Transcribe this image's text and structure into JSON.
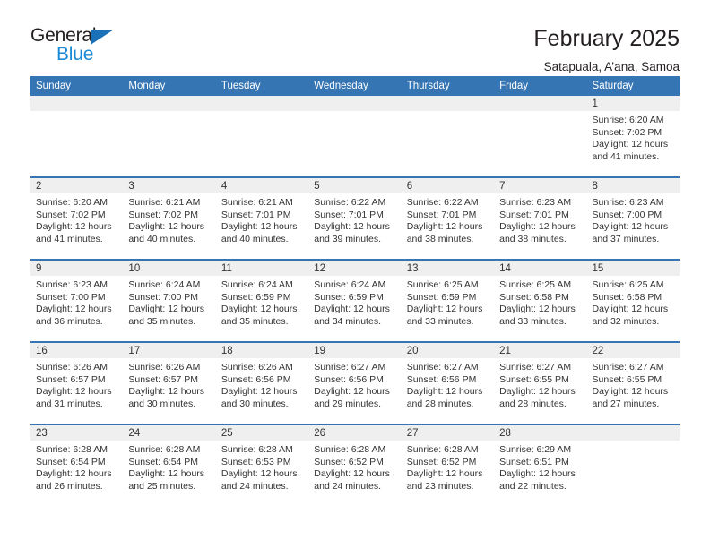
{
  "logo": {
    "word_one": "General",
    "word_two": "Blue",
    "triangle_icon": "triangle-icon",
    "brand_dark": "#231f20",
    "brand_blue": "#1b8ad6",
    "triangle_blue": "#1b71b8"
  },
  "header": {
    "month_title": "February 2025",
    "location": "Satapuala, A’ana, Samoa"
  },
  "colors": {
    "header_row": "#3575b4",
    "daynum_band": "#efefef",
    "text": "#333333"
  },
  "calendar": {
    "weekday_headers": [
      "Sunday",
      "Monday",
      "Tuesday",
      "Wednesday",
      "Thursday",
      "Friday",
      "Saturday"
    ],
    "labels": {
      "sunrise": "Sunrise:",
      "sunset": "Sunset:",
      "daylight": "Daylight:"
    },
    "weeks": [
      [
        {
          "day": "",
          "sunrise": "",
          "sunset": "",
          "daylight": ""
        },
        {
          "day": "",
          "sunrise": "",
          "sunset": "",
          "daylight": ""
        },
        {
          "day": "",
          "sunrise": "",
          "sunset": "",
          "daylight": ""
        },
        {
          "day": "",
          "sunrise": "",
          "sunset": "",
          "daylight": ""
        },
        {
          "day": "",
          "sunrise": "",
          "sunset": "",
          "daylight": ""
        },
        {
          "day": "",
          "sunrise": "",
          "sunset": "",
          "daylight": ""
        },
        {
          "day": "1",
          "sunrise": "Sunrise: 6:20 AM",
          "sunset": "Sunset: 7:02 PM",
          "daylight": "Daylight: 12 hours and 41 minutes."
        }
      ],
      [
        {
          "day": "2",
          "sunrise": "Sunrise: 6:20 AM",
          "sunset": "Sunset: 7:02 PM",
          "daylight": "Daylight: 12 hours and 41 minutes."
        },
        {
          "day": "3",
          "sunrise": "Sunrise: 6:21 AM",
          "sunset": "Sunset: 7:02 PM",
          "daylight": "Daylight: 12 hours and 40 minutes."
        },
        {
          "day": "4",
          "sunrise": "Sunrise: 6:21 AM",
          "sunset": "Sunset: 7:01 PM",
          "daylight": "Daylight: 12 hours and 40 minutes."
        },
        {
          "day": "5",
          "sunrise": "Sunrise: 6:22 AM",
          "sunset": "Sunset: 7:01 PM",
          "daylight": "Daylight: 12 hours and 39 minutes."
        },
        {
          "day": "6",
          "sunrise": "Sunrise: 6:22 AM",
          "sunset": "Sunset: 7:01 PM",
          "daylight": "Daylight: 12 hours and 38 minutes."
        },
        {
          "day": "7",
          "sunrise": "Sunrise: 6:23 AM",
          "sunset": "Sunset: 7:01 PM",
          "daylight": "Daylight: 12 hours and 38 minutes."
        },
        {
          "day": "8",
          "sunrise": "Sunrise: 6:23 AM",
          "sunset": "Sunset: 7:00 PM",
          "daylight": "Daylight: 12 hours and 37 minutes."
        }
      ],
      [
        {
          "day": "9",
          "sunrise": "Sunrise: 6:23 AM",
          "sunset": "Sunset: 7:00 PM",
          "daylight": "Daylight: 12 hours and 36 minutes."
        },
        {
          "day": "10",
          "sunrise": "Sunrise: 6:24 AM",
          "sunset": "Sunset: 7:00 PM",
          "daylight": "Daylight: 12 hours and 35 minutes."
        },
        {
          "day": "11",
          "sunrise": "Sunrise: 6:24 AM",
          "sunset": "Sunset: 6:59 PM",
          "daylight": "Daylight: 12 hours and 35 minutes."
        },
        {
          "day": "12",
          "sunrise": "Sunrise: 6:24 AM",
          "sunset": "Sunset: 6:59 PM",
          "daylight": "Daylight: 12 hours and 34 minutes."
        },
        {
          "day": "13",
          "sunrise": "Sunrise: 6:25 AM",
          "sunset": "Sunset: 6:59 PM",
          "daylight": "Daylight: 12 hours and 33 minutes."
        },
        {
          "day": "14",
          "sunrise": "Sunrise: 6:25 AM",
          "sunset": "Sunset: 6:58 PM",
          "daylight": "Daylight: 12 hours and 33 minutes."
        },
        {
          "day": "15",
          "sunrise": "Sunrise: 6:25 AM",
          "sunset": "Sunset: 6:58 PM",
          "daylight": "Daylight: 12 hours and 32 minutes."
        }
      ],
      [
        {
          "day": "16",
          "sunrise": "Sunrise: 6:26 AM",
          "sunset": "Sunset: 6:57 PM",
          "daylight": "Daylight: 12 hours and 31 minutes."
        },
        {
          "day": "17",
          "sunrise": "Sunrise: 6:26 AM",
          "sunset": "Sunset: 6:57 PM",
          "daylight": "Daylight: 12 hours and 30 minutes."
        },
        {
          "day": "18",
          "sunrise": "Sunrise: 6:26 AM",
          "sunset": "Sunset: 6:56 PM",
          "daylight": "Daylight: 12 hours and 30 minutes."
        },
        {
          "day": "19",
          "sunrise": "Sunrise: 6:27 AM",
          "sunset": "Sunset: 6:56 PM",
          "daylight": "Daylight: 12 hours and 29 minutes."
        },
        {
          "day": "20",
          "sunrise": "Sunrise: 6:27 AM",
          "sunset": "Sunset: 6:56 PM",
          "daylight": "Daylight: 12 hours and 28 minutes."
        },
        {
          "day": "21",
          "sunrise": "Sunrise: 6:27 AM",
          "sunset": "Sunset: 6:55 PM",
          "daylight": "Daylight: 12 hours and 28 minutes."
        },
        {
          "day": "22",
          "sunrise": "Sunrise: 6:27 AM",
          "sunset": "Sunset: 6:55 PM",
          "daylight": "Daylight: 12 hours and 27 minutes."
        }
      ],
      [
        {
          "day": "23",
          "sunrise": "Sunrise: 6:28 AM",
          "sunset": "Sunset: 6:54 PM",
          "daylight": "Daylight: 12 hours and 26 minutes."
        },
        {
          "day": "24",
          "sunrise": "Sunrise: 6:28 AM",
          "sunset": "Sunset: 6:54 PM",
          "daylight": "Daylight: 12 hours and 25 minutes."
        },
        {
          "day": "25",
          "sunrise": "Sunrise: 6:28 AM",
          "sunset": "Sunset: 6:53 PM",
          "daylight": "Daylight: 12 hours and 24 minutes."
        },
        {
          "day": "26",
          "sunrise": "Sunrise: 6:28 AM",
          "sunset": "Sunset: 6:52 PM",
          "daylight": "Daylight: 12 hours and 24 minutes."
        },
        {
          "day": "27",
          "sunrise": "Sunrise: 6:28 AM",
          "sunset": "Sunset: 6:52 PM",
          "daylight": "Daylight: 12 hours and 23 minutes."
        },
        {
          "day": "28",
          "sunrise": "Sunrise: 6:29 AM",
          "sunset": "Sunset: 6:51 PM",
          "daylight": "Daylight: 12 hours and 22 minutes."
        },
        {
          "day": "",
          "sunrise": "",
          "sunset": "",
          "daylight": ""
        }
      ]
    ]
  }
}
